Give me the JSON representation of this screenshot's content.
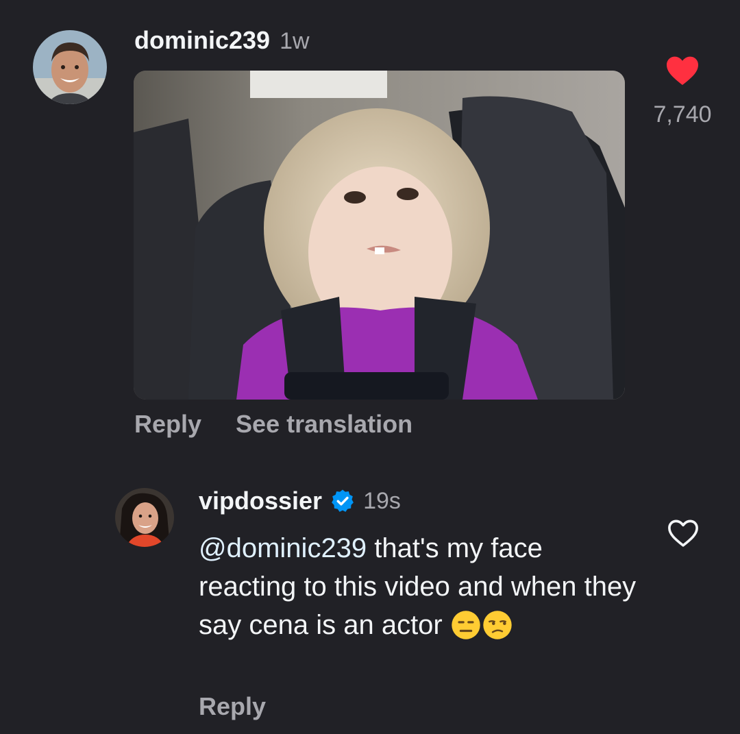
{
  "comment1": {
    "username": "dominic239",
    "time": "1w",
    "like_count": "7,740",
    "liked": true,
    "actions": {
      "reply": "Reply",
      "translate": "See translation"
    },
    "media_icon": "gif-image"
  },
  "comment2": {
    "username": "vipdossier",
    "verified": true,
    "time": "19s",
    "mention": "@dominic239",
    "text": " that's my face reacting to this video and when they say cena is an actor",
    "emojis": [
      "expressionless-face-icon",
      "unamused-face-icon"
    ],
    "liked": false,
    "reply": "Reply"
  },
  "colors": {
    "background": "#212126",
    "primary_text": "#f3f5f7",
    "secondary_text": "#a8a8ae",
    "like_red": "#ff3040",
    "verified_blue": "#0095f6"
  }
}
